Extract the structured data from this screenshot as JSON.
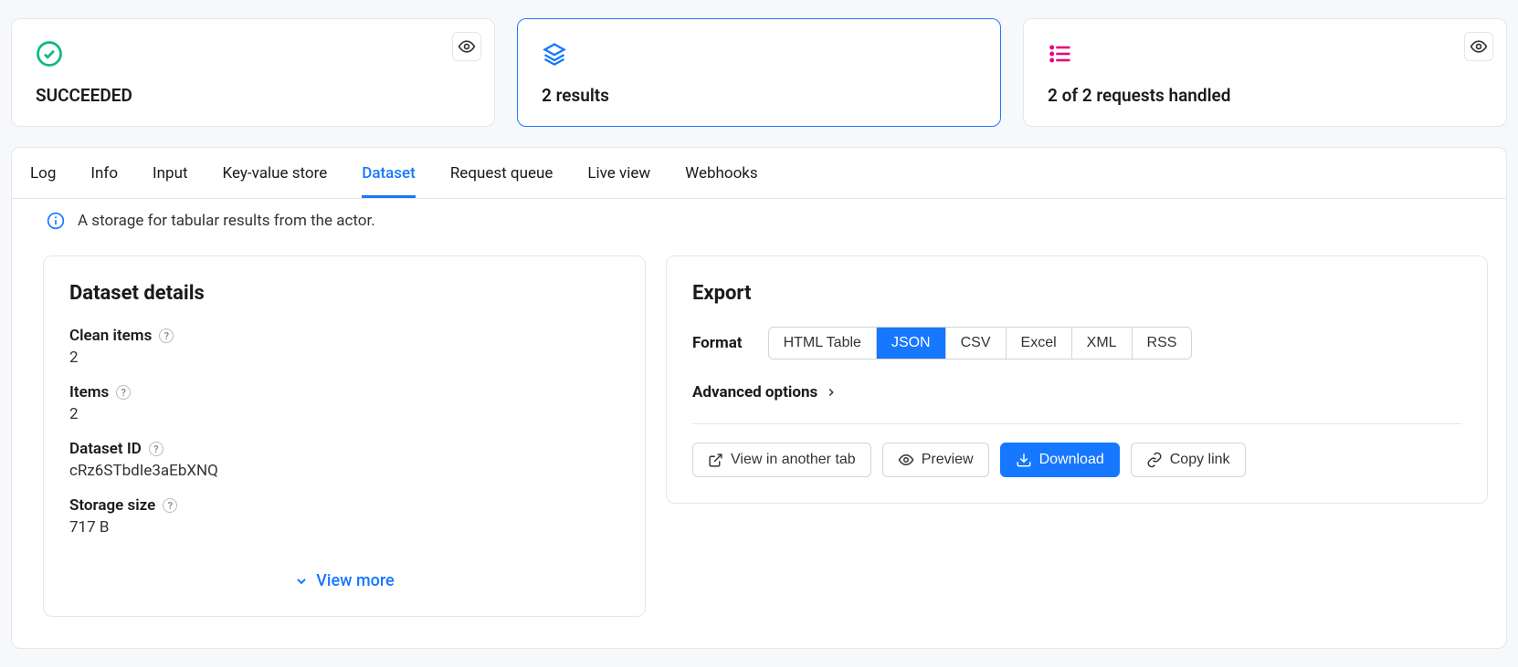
{
  "status_cards": {
    "succeeded": {
      "label": "SUCCEEDED"
    },
    "results": {
      "label": "2 results"
    },
    "requests": {
      "label": "2 of 2 requests handled"
    }
  },
  "tabs": {
    "log": "Log",
    "info": "Info",
    "input": "Input",
    "kvstore": "Key-value store",
    "dataset": "Dataset",
    "request_queue": "Request queue",
    "live_view": "Live view",
    "webhooks": "Webhooks"
  },
  "info_text": "A storage for tabular results from the actor.",
  "dataset_details": {
    "title": "Dataset details",
    "clean_items_label": "Clean items",
    "clean_items_value": "2",
    "items_label": "Items",
    "items_value": "2",
    "dataset_id_label": "Dataset ID",
    "dataset_id_value": "cRz6STbdIe3aEbXNQ",
    "storage_size_label": "Storage size",
    "storage_size_value": "717 B",
    "view_more": "View more"
  },
  "export": {
    "title": "Export",
    "format_label": "Format",
    "formats": {
      "html": "HTML Table",
      "json": "JSON",
      "csv": "CSV",
      "excel": "Excel",
      "xml": "XML",
      "rss": "RSS"
    },
    "advanced": "Advanced options",
    "view_tab": "View in another tab",
    "preview": "Preview",
    "download": "Download",
    "copy_link": "Copy link"
  }
}
